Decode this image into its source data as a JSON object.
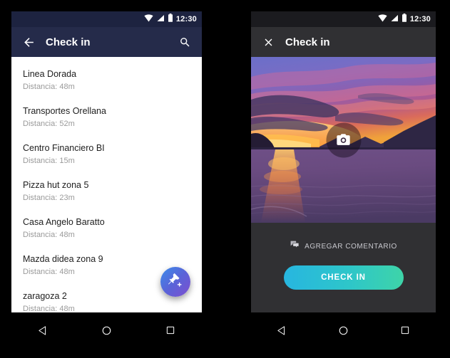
{
  "left_phone": {
    "status_bar": {
      "time": "12:30",
      "icons": [
        "wifi-icon",
        "signal-icon",
        "battery-icon"
      ]
    },
    "app_bar": {
      "back_label": "back-arrow-icon",
      "title": "Check in",
      "search_label": "search-icon"
    },
    "list": [
      {
        "name": "Linea Dorada",
        "distance": "Distancia: 48m"
      },
      {
        "name": "Transportes Orellana",
        "distance": "Distancia: 52m"
      },
      {
        "name": "Centro Financiero BI",
        "distance": "Distancia: 15m"
      },
      {
        "name": "Pizza hut zona 5",
        "distance": "Distancia: 23m"
      },
      {
        "name": "Casa Angelo Baratto",
        "distance": "Distancia: 48m"
      },
      {
        "name": "Mazda didea zona 9",
        "distance": "Distancia: 48m"
      },
      {
        "name": "zaragoza 2",
        "distance": "Distancia: 48m"
      }
    ],
    "fab": {
      "icon": "add-pin-icon"
    },
    "nav": {
      "back": "back-triangle-icon",
      "home": "home-circle-icon",
      "recents": "recents-square-icon"
    }
  },
  "right_phone": {
    "status_bar": {
      "time": "12:30",
      "icons": [
        "wifi-icon",
        "signal-icon",
        "battery-icon"
      ]
    },
    "app_bar": {
      "close_label": "close-icon",
      "title": "Check in"
    },
    "photo": {
      "alt": "sunset-lake-photo",
      "camera_button": "camera-icon"
    },
    "comment": {
      "icon": "forum-icon",
      "label": "AGREGAR COMENTARIO"
    },
    "checkin_button": {
      "label": "CHECK IN"
    },
    "nav": {
      "back": "back-triangle-icon",
      "home": "home-circle-icon",
      "recents": "recents-square-icon"
    }
  },
  "colors": {
    "left_appbar": "#252b4a",
    "left_statusbar": "#1d2340",
    "right_appbar": "#303033",
    "right_statusbar": "#1b1b1f",
    "fab_gradient_start": "#3c8dea",
    "fab_gradient_end": "#7e4fd0",
    "checkin_gradient_start": "#27b6e0",
    "checkin_gradient_end": "#3ed4a8",
    "list_bg": "#ffffff",
    "list_title": "#212121",
    "list_sub": "#9a9a9a",
    "navbar": "#000000"
  }
}
